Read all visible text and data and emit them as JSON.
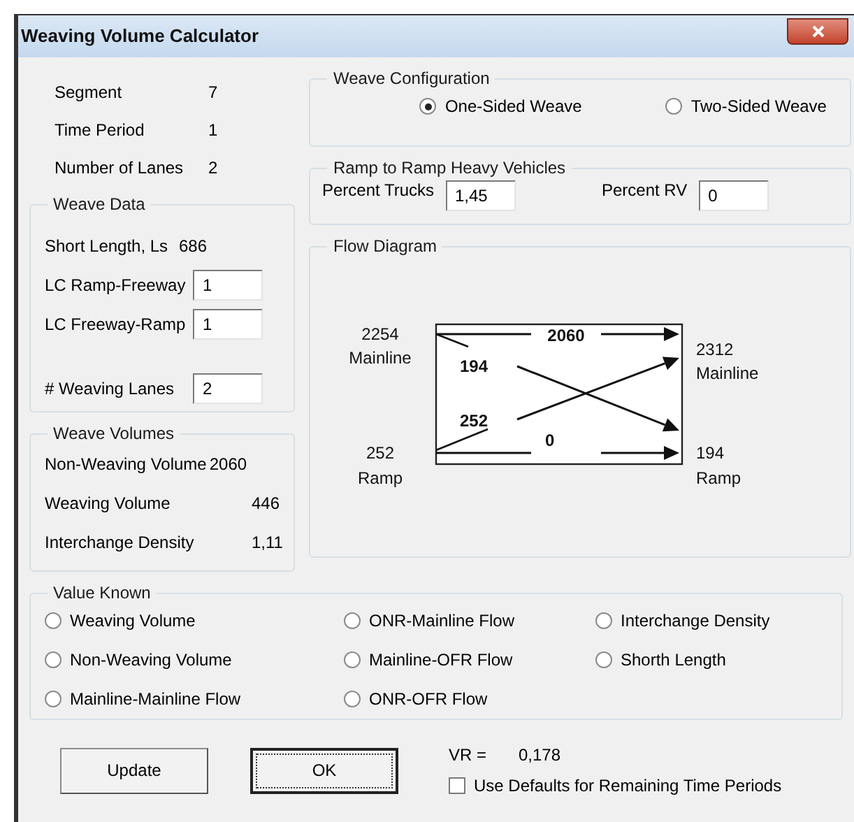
{
  "window": {
    "title": "Weaving Volume Calculator"
  },
  "segment_info": [
    {
      "label": "Segment",
      "value": "7"
    },
    {
      "label": "Time Period",
      "value": "1"
    },
    {
      "label": "Number of Lanes",
      "value": "2"
    }
  ],
  "weave_data": {
    "title": "Weave Data",
    "short_length": {
      "label": "Short Length, Ls",
      "value": "686"
    },
    "fields": [
      {
        "label": "LC Ramp-Freeway",
        "value": "1"
      },
      {
        "label": "LC Freeway-Ramp",
        "value": "1"
      }
    ],
    "weaving_lanes": {
      "label": "# Weaving Lanes",
      "value": "2"
    }
  },
  "weave_volumes": {
    "title": "Weave Volumes",
    "rows": [
      {
        "label": "Non-Weaving Volume",
        "value": "2060"
      },
      {
        "label": "Weaving Volume",
        "value": "446"
      },
      {
        "label": "Interchange Density",
        "value": "1,11"
      }
    ]
  },
  "weave_configuration": {
    "title": "Weave Configuration",
    "options": [
      {
        "label": "One-Sided Weave",
        "selected": true
      },
      {
        "label": "Two-Sided Weave",
        "selected": false
      }
    ]
  },
  "ramp_heavy_vehicles": {
    "title": "Ramp to Ramp Heavy Vehicles",
    "fields": [
      {
        "label": "Percent Trucks",
        "value": "1,45"
      },
      {
        "label": "Percent RV",
        "value": "0"
      }
    ]
  },
  "flow_diagram": {
    "title": "Flow Diagram",
    "inputs": [
      {
        "value": "2254",
        "label": "Mainline"
      },
      {
        "value": "252",
        "label": "Ramp"
      }
    ],
    "outputs": [
      {
        "value": "2312",
        "label": "Mainline"
      },
      {
        "value": "194",
        "label": "Ramp"
      }
    ],
    "flows": {
      "mainline_to_mainline": "2060",
      "mainline_to_ramp": "194",
      "ramp_to_mainline": "252",
      "ramp_to_ramp": "0"
    }
  },
  "value_known": {
    "title": "Value Known",
    "options": [
      {
        "label": "Weaving Volume",
        "selected": false
      },
      {
        "label": "Non-Weaving Volume",
        "selected": false
      },
      {
        "label": "Mainline-Mainline Flow",
        "selected": false
      },
      {
        "label": "ONR-Mainline Flow",
        "selected": false
      },
      {
        "label": "Mainline-OFR Flow",
        "selected": false
      },
      {
        "label": "ONR-OFR Flow",
        "selected": false
      },
      {
        "label": "Interchange Density",
        "selected": false
      },
      {
        "label": "Shorth Length",
        "selected": false
      }
    ]
  },
  "buttons": [
    {
      "label": "Update",
      "kind": "normal"
    },
    {
      "label": "OK",
      "kind": "default"
    }
  ],
  "vr": {
    "label": "VR =",
    "value": "0,178"
  },
  "use_defaults": {
    "label": "Use Defaults for Remaining Time Periods",
    "checked": false
  }
}
